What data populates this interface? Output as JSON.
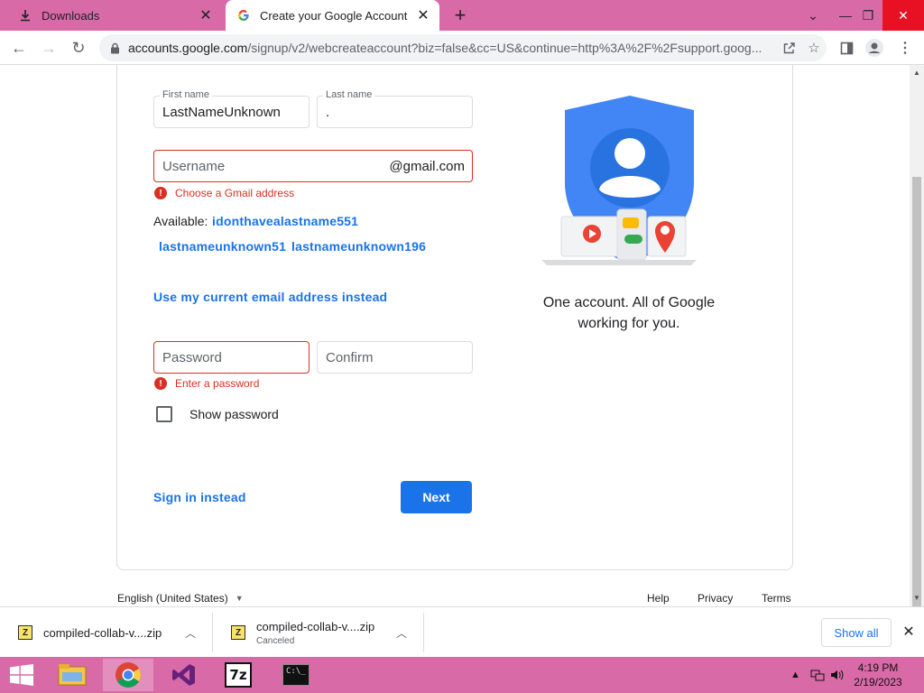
{
  "browser": {
    "tabs": [
      {
        "title": "Downloads",
        "active": false
      },
      {
        "title": "Create your Google Account",
        "active": true
      }
    ],
    "address": {
      "host": "accounts.google.com",
      "path": "/signup/v2/webcreateaccount?biz=false&cc=US&continue=http%3A%2F%2Fsupport.goog..."
    }
  },
  "form": {
    "first_name": {
      "label": "First name",
      "value": "LastNameUnknown"
    },
    "last_name": {
      "label": "Last name",
      "value": "."
    },
    "username": {
      "placeholder": "Username",
      "suffix": "@gmail.com",
      "error": "Choose a Gmail address"
    },
    "available_label": "Available:",
    "suggestions": [
      "idonthavealastname551",
      "lastnameunknown51",
      "lastnameunknown196"
    ],
    "use_current_email": "Use my current email address instead",
    "password": {
      "placeholder": "Password",
      "error": "Enter a password"
    },
    "confirm": {
      "placeholder": "Confirm"
    },
    "show_password": "Show password",
    "sign_in_instead": "Sign in instead",
    "next": "Next"
  },
  "aside": {
    "tagline_line1": "One account. All of Google",
    "tagline_line2": "working for you."
  },
  "footer": {
    "language": "English (United States)",
    "links": [
      "Help",
      "Privacy",
      "Terms"
    ]
  },
  "downloads": {
    "items": [
      {
        "name": "compiled-collab-v....zip",
        "status": ""
      },
      {
        "name": "compiled-collab-v....zip",
        "status": "Canceled"
      }
    ],
    "show_all": "Show all"
  },
  "taskbar": {
    "time": "4:19 PM",
    "date": "2/19/2023"
  },
  "colors": {
    "accent": "#1a73e8",
    "error": "#d93025",
    "chrome_frame": "#d96aa8"
  }
}
